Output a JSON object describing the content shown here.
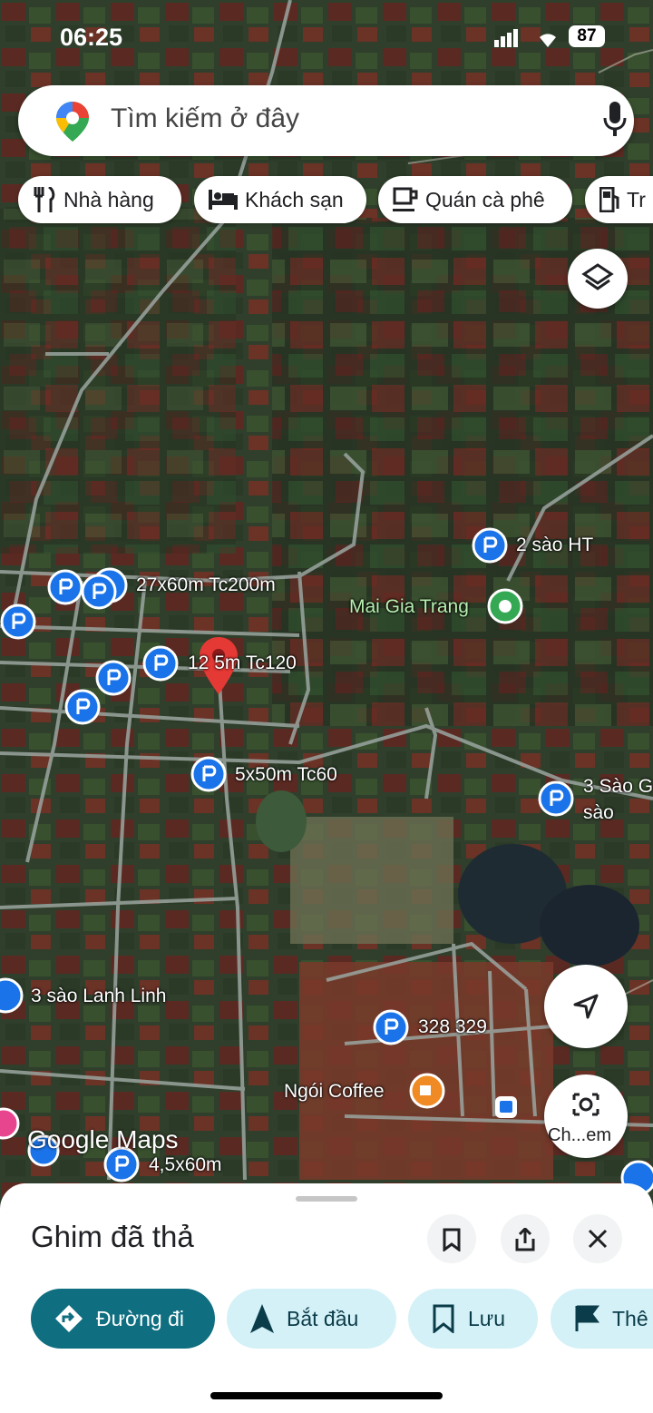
{
  "status": {
    "time": "06:25",
    "battery": "87"
  },
  "search": {
    "placeholder": "Tìm kiếm ở đây"
  },
  "chips": [
    {
      "label": "Nhà hàng",
      "icon": "restaurant-icon"
    },
    {
      "label": "Khách sạn",
      "icon": "hotel-icon"
    },
    {
      "label": "Quán cà phê",
      "icon": "coffee-icon"
    },
    {
      "label": "Tr",
      "icon": "gas-station-icon"
    }
  ],
  "markers": [
    {
      "label": "2 sào HT"
    },
    {
      "label": "27x60m Tc200m"
    },
    {
      "label": "Mai Gia Trang"
    },
    {
      "label": "12 5m Tc120"
    },
    {
      "label": "5x50m Tc60"
    },
    {
      "label": "3 Sào G"
    },
    {
      "label": "sào"
    },
    {
      "label": "3 sào Lanh Linh"
    },
    {
      "label": "328 329"
    },
    {
      "label": "Ngói Coffee"
    },
    {
      "label": "4,5x60m"
    }
  ],
  "watermark": "Google Maps",
  "camera_label": "Ch...em",
  "sheet": {
    "title": "Ghim đã thả",
    "actions": {
      "directions": "Đường đi",
      "start": "Bắt đầu",
      "save": "Lưu",
      "more": "Thê"
    }
  },
  "colors": {
    "accent": "#0f6e80",
    "action_bg": "#d3f1f7",
    "pin": "#e53935",
    "marker_blue": "#1a73e8"
  }
}
